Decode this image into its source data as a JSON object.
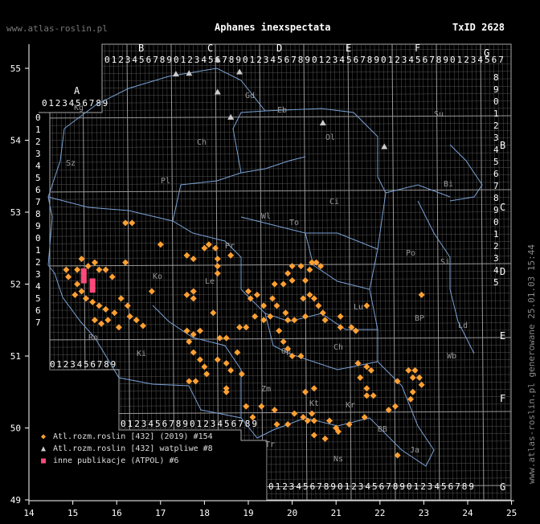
{
  "header": {
    "title": "Aphanes inexspectata",
    "taxid": "TxID 2628",
    "site": "www.atlas-roslin.pl",
    "side_text": "www.atlas-roslin.pl generowane 25.01.03 15:44"
  },
  "colors": {
    "orange": "#ffa033",
    "grey": "#cccccc",
    "pink": "#ff4a7a",
    "border": "#7aa2d6",
    "grid": "#888888"
  },
  "axes": {
    "lon_ticks": [
      "14",
      "15",
      "16",
      "17",
      "18",
      "19",
      "20",
      "21",
      "22",
      "23",
      "24",
      "25"
    ],
    "lat_ticks": [
      "49",
      "50",
      "51",
      "52",
      "53",
      "54",
      "55"
    ]
  },
  "grid_letters": {
    "top": [
      "A",
      "B",
      "C",
      "D",
      "E",
      "F",
      "G"
    ],
    "right": [
      "B",
      "C",
      "D",
      "E",
      "F",
      "G"
    ],
    "regions": [
      "Kg",
      "Sz",
      "Pl",
      "Ch",
      "Gd",
      "Eb",
      "Su",
      "Ol",
      "Bi",
      "Ci",
      "Wl",
      "To",
      "Pr",
      "Ko",
      "Le",
      "Po",
      "Si",
      "BP",
      "Ld",
      "Lu",
      "Ch",
      "Ro",
      "Ki",
      "Op",
      "Wb",
      "Zm",
      "Kt",
      "Kr",
      "Tr",
      "BB",
      "Ns",
      "Ja"
    ]
  },
  "legend": [
    {
      "symbol": "◆",
      "color": "#ffa033",
      "label": "Atl.rozm.roslin [432] (2019) #154"
    },
    {
      "symbol": "▲",
      "color": "#cccccc",
      "label": "Atl.rozm.roslin [432] watpliwe #8"
    },
    {
      "symbol": "■",
      "color": "#ff4a7a",
      "label": "inne publikacje (ATPOL) #6"
    }
  ],
  "chart_data": {
    "type": "scatter",
    "xlim": [
      14,
      25
    ],
    "ylim": [
      49,
      55.6
    ],
    "orange_points": [
      [
        14.85,
        52.2
      ],
      [
        14.9,
        52.1
      ],
      [
        15.1,
        52.2
      ],
      [
        15.2,
        52.35
      ],
      [
        15.35,
        52.25
      ],
      [
        15.5,
        52.3
      ],
      [
        15.6,
        52.2
      ],
      [
        15.75,
        52.2
      ],
      [
        15.9,
        52.1
      ],
      [
        15.1,
        52.0
      ],
      [
        15.2,
        51.9
      ],
      [
        15.05,
        51.85
      ],
      [
        15.3,
        51.8
      ],
      [
        15.45,
        51.75
      ],
      [
        15.6,
        51.7
      ],
      [
        15.75,
        51.65
      ],
      [
        15.95,
        51.6
      ],
      [
        16.1,
        51.8
      ],
      [
        15.5,
        51.5
      ],
      [
        15.65,
        51.45
      ],
      [
        15.8,
        51.5
      ],
      [
        16.05,
        51.4
      ],
      [
        16.25,
        51.7
      ],
      [
        16.3,
        51.55
      ],
      [
        16.45,
        51.5
      ],
      [
        16.6,
        51.42
      ],
      [
        16.8,
        51.9
      ],
      [
        16.2,
        52.3
      ],
      [
        16.2,
        52.85
      ],
      [
        16.35,
        52.85
      ],
      [
        17.0,
        52.55
      ],
      [
        17.6,
        52.4
      ],
      [
        17.75,
        52.35
      ],
      [
        18.0,
        52.5
      ],
      [
        18.1,
        52.55
      ],
      [
        18.25,
        52.5
      ],
      [
        18.3,
        52.35
      ],
      [
        18.3,
        52.25
      ],
      [
        18.3,
        52.15
      ],
      [
        18.6,
        52.4
      ],
      [
        17.6,
        51.85
      ],
      [
        17.75,
        51.8
      ],
      [
        17.75,
        51.9
      ],
      [
        18.2,
        51.6
      ],
      [
        17.6,
        51.35
      ],
      [
        17.75,
        51.3
      ],
      [
        17.9,
        51.35
      ],
      [
        17.65,
        51.2
      ],
      [
        17.75,
        51.05
      ],
      [
        17.9,
        50.95
      ],
      [
        18.0,
        50.85
      ],
      [
        17.65,
        50.65
      ],
      [
        17.8,
        50.65
      ],
      [
        18.05,
        50.75
      ],
      [
        18.35,
        51.25
      ],
      [
        18.5,
        51.25
      ],
      [
        18.3,
        50.95
      ],
      [
        18.5,
        50.9
      ],
      [
        18.6,
        50.8
      ],
      [
        18.75,
        51.05
      ],
      [
        18.85,
        50.75
      ],
      [
        18.5,
        50.55
      ],
      [
        18.5,
        50.5
      ],
      [
        18.8,
        51.4
      ],
      [
        18.95,
        51.4
      ],
      [
        19.0,
        51.9
      ],
      [
        19.05,
        51.8
      ],
      [
        19.2,
        51.85
      ],
      [
        19.35,
        51.7
      ],
      [
        19.55,
        51.8
      ],
      [
        19.65,
        51.7
      ],
      [
        19.15,
        51.55
      ],
      [
        19.35,
        51.5
      ],
      [
        19.5,
        51.55
      ],
      [
        19.7,
        51.35
      ],
      [
        19.8,
        51.2
      ],
      [
        19.9,
        51.1
      ],
      [
        20.0,
        51.0
      ],
      [
        20.2,
        51.0
      ],
      [
        19.6,
        52.0
      ],
      [
        19.8,
        52.0
      ],
      [
        20.0,
        52.05
      ],
      [
        19.9,
        52.15
      ],
      [
        20.0,
        52.25
      ],
      [
        20.2,
        52.25
      ],
      [
        20.3,
        52.05
      ],
      [
        20.4,
        52.2
      ],
      [
        20.45,
        52.3
      ],
      [
        20.55,
        52.3
      ],
      [
        20.65,
        52.25
      ],
      [
        20.25,
        51.8
      ],
      [
        20.4,
        51.85
      ],
      [
        20.5,
        51.8
      ],
      [
        20.6,
        51.7
      ],
      [
        20.7,
        51.6
      ],
      [
        20.75,
        51.5
      ],
      [
        20.3,
        51.55
      ],
      [
        19.85,
        51.6
      ],
      [
        19.9,
        51.5
      ],
      [
        20.05,
        51.5
      ],
      [
        21.1,
        51.4
      ],
      [
        21.35,
        51.4
      ],
      [
        21.45,
        51.35
      ],
      [
        21.7,
        51.7
      ],
      [
        21.1,
        51.55
      ],
      [
        22.95,
        51.85
      ],
      [
        20.5,
        50.55
      ],
      [
        20.3,
        50.5
      ],
      [
        19.3,
        50.3
      ],
      [
        19.6,
        50.25
      ],
      [
        20.05,
        50.2
      ],
      [
        20.25,
        50.15
      ],
      [
        20.35,
        50.1
      ],
      [
        20.45,
        50.2
      ],
      [
        20.5,
        50.1
      ],
      [
        20.85,
        50.1
      ],
      [
        21.0,
        50.0
      ],
      [
        21.3,
        50.05
      ],
      [
        21.65,
        50.15
      ],
      [
        21.7,
        50.45
      ],
      [
        21.7,
        50.55
      ],
      [
        21.85,
        50.45
      ],
      [
        21.5,
        50.9
      ],
      [
        21.7,
        50.85
      ],
      [
        21.8,
        50.8
      ],
      [
        21.55,
        50.7
      ],
      [
        22.4,
        50.65
      ],
      [
        22.65,
        50.8
      ],
      [
        22.75,
        50.7
      ],
      [
        22.8,
        50.8
      ],
      [
        22.9,
        50.7
      ],
      [
        22.95,
        50.6
      ],
      [
        22.75,
        50.5
      ],
      [
        22.7,
        50.4
      ],
      [
        22.2,
        50.25
      ],
      [
        22.35,
        50.3
      ],
      [
        22.4,
        49.62
      ],
      [
        20.5,
        49.9
      ],
      [
        20.75,
        49.85
      ],
      [
        21.05,
        49.95
      ],
      [
        19.9,
        50.05
      ],
      [
        19.65,
        50.05
      ],
      [
        19.1,
        50.15
      ],
      [
        18.95,
        50.3
      ]
    ],
    "grey_points": [
      [
        17.35,
        54.92
      ],
      [
        17.65,
        54.93
      ],
      [
        18.3,
        55.12
      ],
      [
        18.8,
        54.95
      ],
      [
        18.3,
        54.67
      ],
      [
        18.6,
        54.32
      ],
      [
        20.7,
        54.24
      ],
      [
        22.1,
        53.91
      ]
    ],
    "pink_points": [
      [
        15.25,
        52.18
      ],
      [
        15.25,
        52.12
      ],
      [
        15.25,
        52.05
      ],
      [
        15.45,
        51.98
      ],
      [
        15.45,
        51.92
      ],
      [
        15.45,
        52.04
      ]
    ]
  }
}
